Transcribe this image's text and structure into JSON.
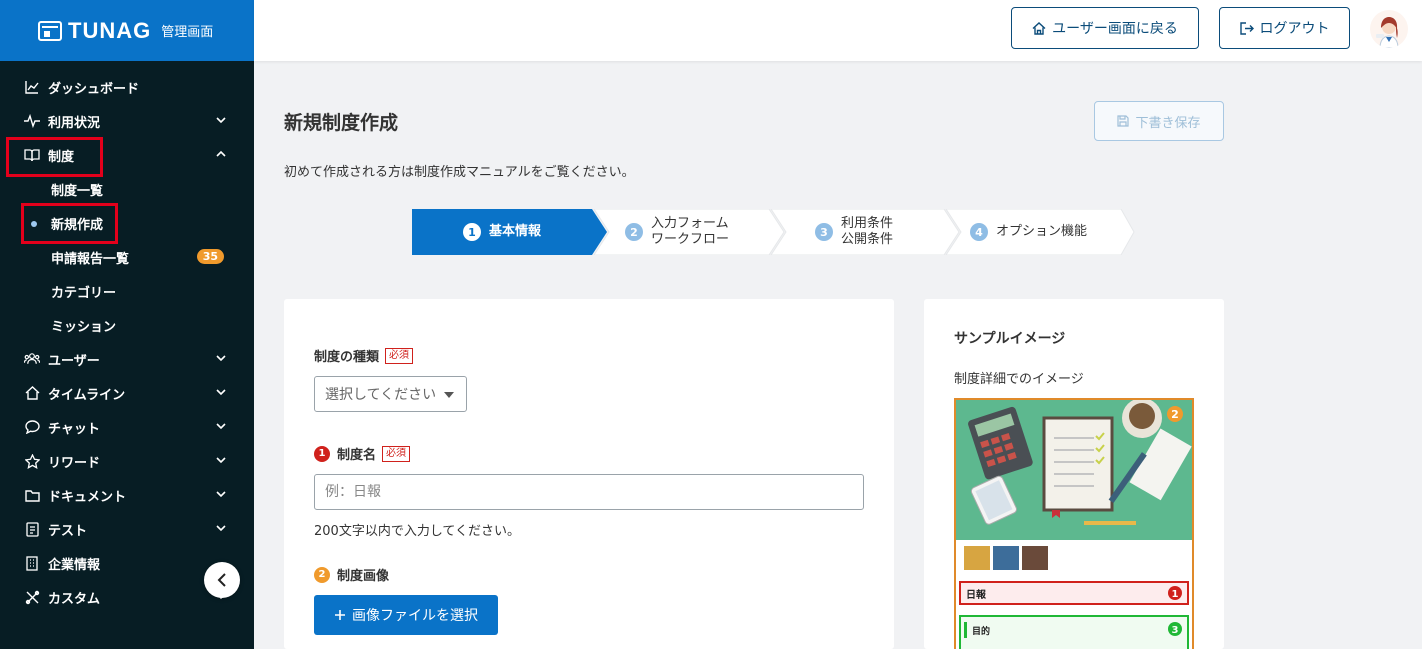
{
  "brand": {
    "logo": "TUNAG",
    "subtitle": "管理画面"
  },
  "sidebar": {
    "items": [
      {
        "label": "ダッシュボード"
      },
      {
        "label": "利用状況"
      },
      {
        "label": "制度"
      },
      {
        "label": "ユーザー"
      },
      {
        "label": "タイムライン"
      },
      {
        "label": "チャット"
      },
      {
        "label": "リワード"
      },
      {
        "label": "ドキュメント"
      },
      {
        "label": "テスト"
      },
      {
        "label": "企業情報"
      },
      {
        "label": "カスタム"
      }
    ],
    "subitems": [
      {
        "label": "制度一覧"
      },
      {
        "label": "新規作成"
      },
      {
        "label": "申請報告一覧",
        "badge": "35"
      },
      {
        "label": "カテゴリー"
      },
      {
        "label": "ミッション"
      }
    ]
  },
  "header": {
    "back_label": "ユーザー画面に戻る",
    "logout_label": "ログアウト"
  },
  "page": {
    "title": "新規制度作成",
    "draft_label": "下書き保存",
    "intro": "初めて作成される方は制度作成マニュアルをご覧ください。"
  },
  "steps": [
    {
      "num": "1",
      "line1": "基本情報",
      "line2": ""
    },
    {
      "num": "2",
      "line1": "入力フォーム",
      "line2": "ワークフロー"
    },
    {
      "num": "3",
      "line1": "利用条件",
      "line2": "公開条件"
    },
    {
      "num": "4",
      "line1": "オプション機能",
      "line2": ""
    }
  ],
  "form": {
    "type_label": "制度の種類",
    "required": "必須",
    "type_placeholder": "選択してください",
    "name_num": "1",
    "name_label": "制度名",
    "name_placeholder": "例：日報",
    "name_hint": "200文字以内で入力してください。",
    "image_num": "2",
    "image_label": "制度画像",
    "upload_label": "画像ファイルを選択"
  },
  "sample": {
    "title": "サンプルイメージ",
    "subtitle": "制度詳細でのイメージ",
    "badge_image": "2",
    "badge_name": "1",
    "badge_purpose": "3",
    "name_text": "日報",
    "purpose_text": "目的"
  },
  "colors": {
    "brand_blue": "#0a73c8",
    "sidebar_bg": "#071d24",
    "highlight_red": "#e3001b",
    "badge_orange": "#f09a2c"
  }
}
